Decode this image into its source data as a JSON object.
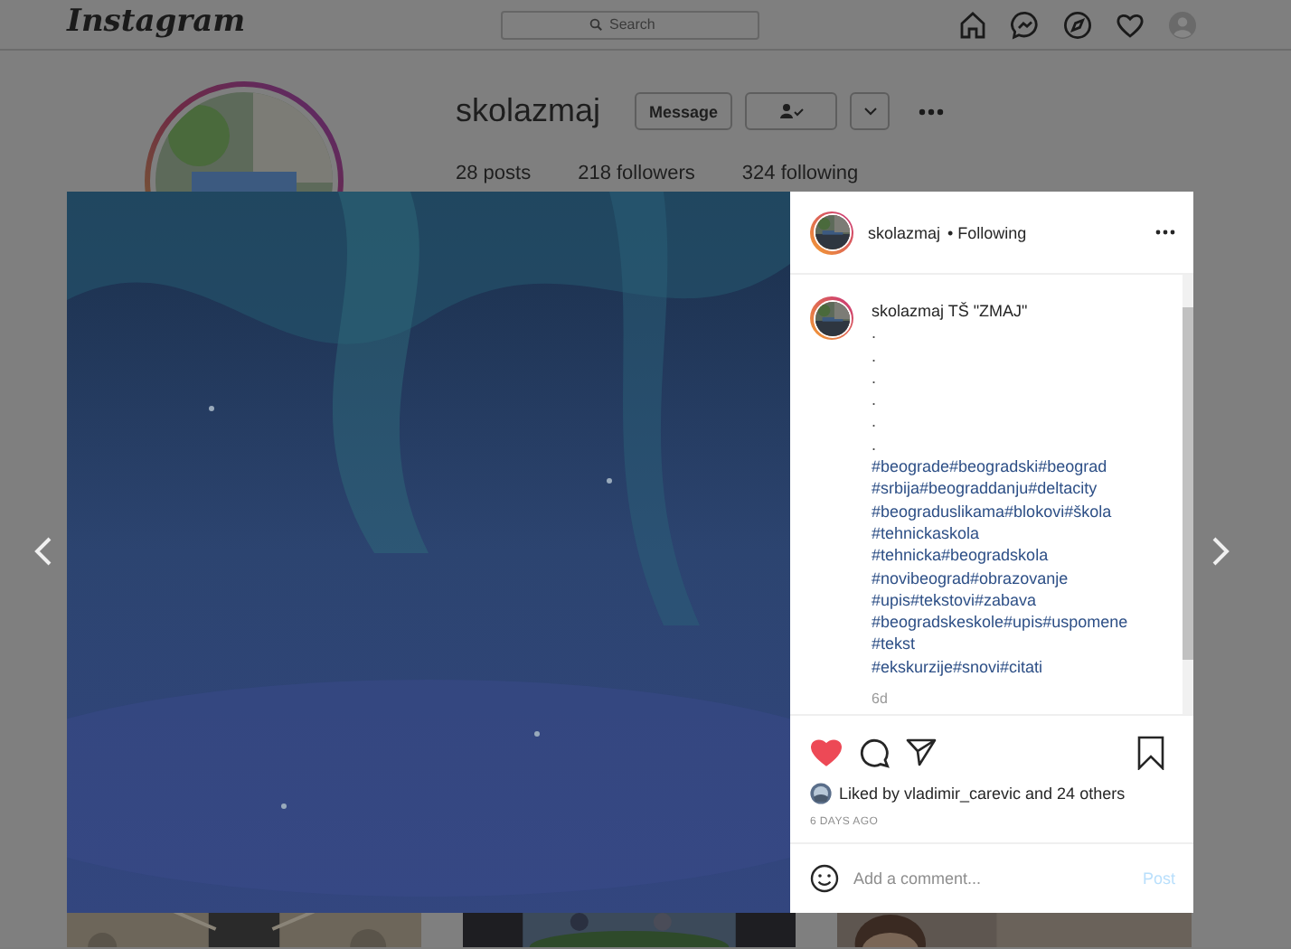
{
  "header": {
    "logo": "Instagram",
    "search": {
      "placeholder": "Search"
    }
  },
  "profile": {
    "username": "skolazmaj",
    "buttons": [
      "Message"
    ],
    "stats": [
      "28 posts",
      "218 followers",
      "324 following"
    ]
  },
  "post": {
    "author": "skolazmaj",
    "follow_label": "• Following",
    "caption": {
      "author": "skolazmaj",
      "text": "TŠ \"ZMAJ\"",
      "lines": [
        ".",
        ".",
        ".",
        ".",
        ".",
        "."
      ],
      "hashtags": [
        "#beograde#beogradski#beograd",
        "#srbija#beograddanju#deltacity",
        "#beograduslikama#blokovi#škola",
        "#tehnickaskola",
        "#tehnicka#beogradskola",
        "#novibeograd#obrazovanje",
        "#upis#tekstovi#zabava",
        "#beogradskeskole#upis#uspomene",
        "#tekst",
        "#ekskurzije#snovi#citati"
      ],
      "age": "6d"
    },
    "liked": true,
    "saved": false,
    "likes": "Liked by vladimir_carevic and 24 others",
    "date": "6 DAYS AGO",
    "comment": {
      "placeholder": "Add a comment...",
      "post_button": "Post",
      "disabled": true
    }
  }
}
